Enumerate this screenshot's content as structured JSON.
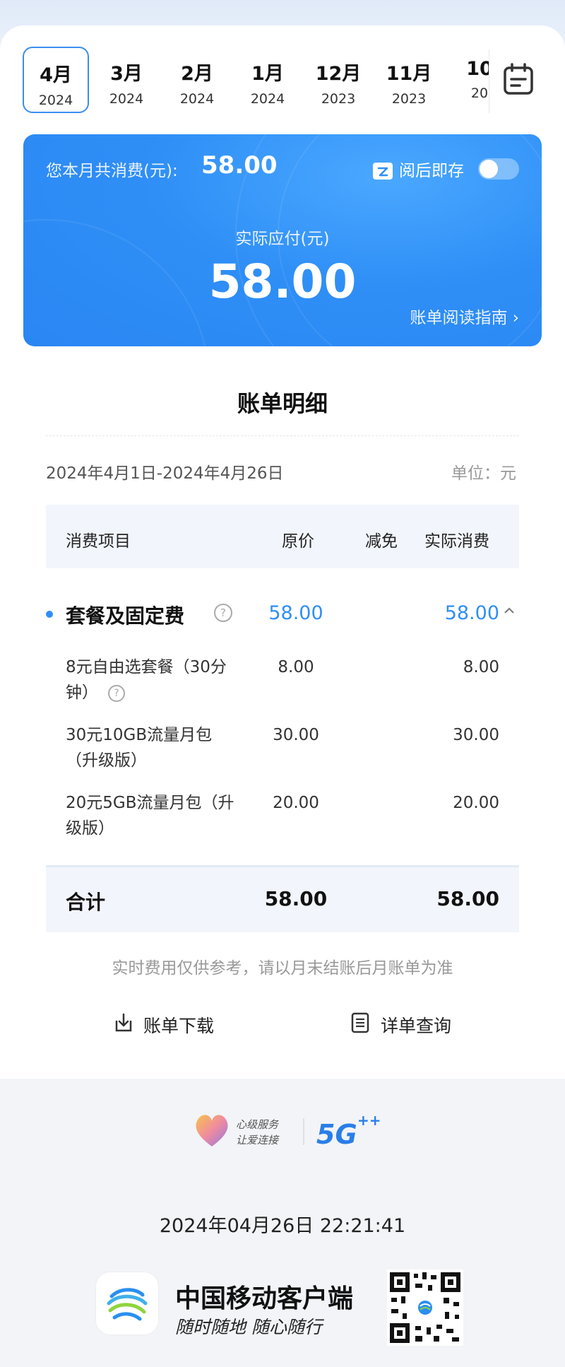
{
  "months": [
    {
      "month": "4月",
      "year": "2024",
      "active": true
    },
    {
      "month": "3月",
      "year": "2024",
      "active": false
    },
    {
      "month": "2月",
      "year": "2024",
      "active": false
    },
    {
      "month": "1月",
      "year": "2024",
      "active": false
    },
    {
      "month": "12月",
      "year": "2023",
      "active": false
    },
    {
      "month": "11月",
      "year": "2023",
      "active": false
    },
    {
      "month": "10",
      "year": "20",
      "active": false
    }
  ],
  "summary": {
    "total_label": "您本月共消费(元):",
    "total_value": "58.00",
    "store_label": "阅后即存",
    "toggle_on": false,
    "pay_label": "实际应付(元)",
    "pay_value": "58.00",
    "guide_label": "账单阅读指南 ›"
  },
  "detail": {
    "title": "账单明细",
    "period": "2024年4月1日-2024年4月26日",
    "unit": "单位：元",
    "headers": {
      "item": "消费项目",
      "orig": "原价",
      "disc": "减免",
      "act": "实际消费"
    },
    "group": {
      "name": "套餐及固定费",
      "orig": "58.00",
      "act": "58.00"
    },
    "rows": [
      {
        "name": "8元自由选套餐（30分钟）",
        "orig": "8.00",
        "act": "8.00",
        "help": true
      },
      {
        "name": "30元10GB流量月包（升级版）",
        "orig": "30.00",
        "act": "30.00",
        "help": false
      },
      {
        "name": "20元5GB流量月包（升级版）",
        "orig": "20.00",
        "act": "20.00",
        "help": false
      }
    ],
    "total": {
      "label": "合计",
      "orig": "58.00",
      "act": "58.00"
    },
    "note": "实时费用仅供参考，请以月末结账后月账单为准",
    "download_label": "账单下载",
    "query_label": "详单查询"
  },
  "footer": {
    "slogan_badge_1": "心级服务",
    "slogan_badge_2": "让爱连接",
    "fiveg": "5G",
    "timestamp": "2024年04月26日 22:21:41",
    "app_name": "中国移动客户端",
    "app_slogan": "随时随地 随心随行"
  },
  "colors": {
    "accent": "#2f8ff6",
    "total_bg": "#f2f6fc"
  }
}
